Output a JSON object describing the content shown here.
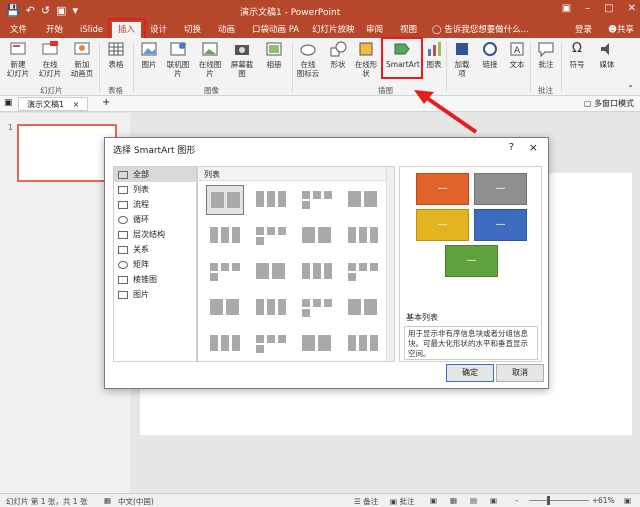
{
  "window": {
    "title": "演示文稿1 - PowerPoint"
  },
  "qat": {
    "save_icon": "save-icon",
    "undo_icon": "undo-icon",
    "redo_icon": "redo-icon"
  },
  "tabs": [
    "文件",
    "开始",
    "iSlide",
    "插入",
    "设计",
    "切换",
    "动画",
    "口袋动画 PA",
    "幻灯片放映",
    "审阅",
    "视图"
  ],
  "tell_me": "告诉我您想要做什么...",
  "account": {
    "login": "登录",
    "share": "共享"
  },
  "ribbon": {
    "buttons": [
      {
        "label": "新建\n幻灯片"
      },
      {
        "label": "在线\n幻灯片"
      },
      {
        "label": "新加\n动画页"
      },
      {
        "label": "表格"
      },
      {
        "label": "图片"
      },
      {
        "label": "联机图片"
      },
      {
        "label": "在线图片"
      },
      {
        "label": "屏幕截图"
      },
      {
        "label": "相册"
      },
      {
        "label": "在线\n图标云"
      },
      {
        "label": "形状"
      },
      {
        "label": "在线形状"
      },
      {
        "label": "SmartArt"
      },
      {
        "label": "图表"
      },
      {
        "label": "加载\n项"
      },
      {
        "label": "链接"
      },
      {
        "label": "文本"
      },
      {
        "label": "批注"
      },
      {
        "label": "符号"
      },
      {
        "label": "媒体"
      }
    ],
    "groups": [
      "幻灯片",
      "表格",
      "图像",
      "插图",
      "批注"
    ]
  },
  "doc_tab": {
    "label": "演示文稿1",
    "close": "×"
  },
  "multi_window": "多窗口模式",
  "thumbnails": {
    "slide_number": "1"
  },
  "dialog": {
    "title": "选择 SmartArt 图形",
    "help": "?",
    "close": "×",
    "categories": [
      "全部",
      "列表",
      "流程",
      "循环",
      "层次结构",
      "关系",
      "矩阵",
      "棱锥图",
      "图片"
    ],
    "selected_category": "全部",
    "gallery_header": "列表",
    "preview_name": "基本列表",
    "preview_description": "用于显示非有序信息块或者分组信息块。可最大化形状的水平和垂直显示空间。",
    "preview_box_label": "—",
    "preview_colors": [
      "#e2632a",
      "#8f8f8f",
      "#e3b41d",
      "#3d6bbf",
      "#5fa13c"
    ],
    "ok": "确定",
    "cancel": "取消"
  },
  "statusbar": {
    "slide_info": "幻灯片 第 1 张，共 1 张",
    "language": "中文(中国)",
    "notes": "备注",
    "comments": "批注",
    "zoom": "61%",
    "zoom_fraction": 0.61
  }
}
